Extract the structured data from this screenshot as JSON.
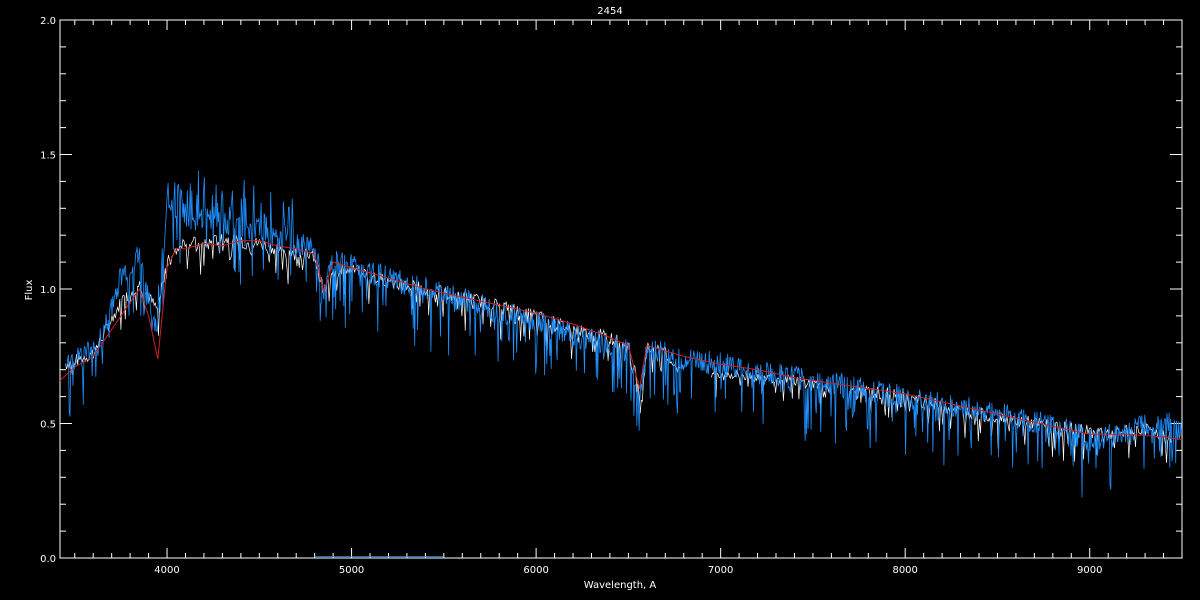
{
  "chart_data": {
    "type": "line",
    "title": "2454",
    "xlabel": "Wavelength, A",
    "ylabel": "Flux",
    "xlim": [
      3420,
      9500
    ],
    "ylim": [
      0.0,
      2.0
    ],
    "xticks": [
      4000,
      5000,
      6000,
      7000,
      8000,
      9000
    ],
    "yticks": [
      0.0,
      0.5,
      1.0,
      1.5,
      2.0
    ],
    "ytick_labels": [
      "0.0",
      "0.5",
      "1.0",
      "1.5",
      "2.0"
    ],
    "grid": false,
    "series": [
      {
        "color": "#ffffff",
        "x": [
          3450,
          3600,
          3750,
          3850,
          3950,
          4000,
          4100,
          4200,
          4300,
          4400,
          4500,
          4600,
          4700,
          4800,
          4850,
          4900,
          5000,
          5200,
          5400,
          5600,
          5800,
          6000,
          6200,
          6400,
          6500,
          6560,
          6600,
          6700,
          6780
        ],
        "y": [
          0.72,
          0.76,
          0.95,
          1.02,
          0.92,
          1.12,
          1.18,
          1.16,
          1.19,
          1.17,
          1.17,
          1.15,
          1.13,
          1.12,
          0.98,
          1.08,
          1.07,
          1.03,
          1.0,
          0.97,
          0.94,
          0.9,
          0.85,
          0.82,
          0.79,
          0.62,
          0.78,
          0.76,
          0.7
        ],
        "segment2_x": [
          6950,
          7100,
          7300,
          7500,
          7600
        ],
        "segment2_y": [
          0.69,
          0.68,
          0.67,
          0.65,
          0.63
        ],
        "segment3_x": [
          7700,
          7900,
          8100,
          8300,
          8500,
          8700,
          8900,
          9100,
          9300,
          9450
        ],
        "segment3_y": [
          0.62,
          0.61,
          0.58,
          0.55,
          0.52,
          0.5,
          0.48,
          0.46,
          0.48,
          0.44
        ]
      },
      {
        "color": "#1e90ff",
        "x": [
          3450,
          3550,
          3650,
          3750,
          3850,
          3900,
          3950,
          4000,
          4050,
          4100,
          4200,
          4300,
          4400,
          4500,
          4600,
          4700,
          4800,
          4850,
          4900,
          5000,
          5200,
          5400,
          5600,
          5800,
          6000,
          6200,
          6400,
          6500,
          6560,
          6600,
          6700,
          6800,
          7000,
          7200,
          7400,
          7600,
          7800,
          8000,
          8200,
          8400,
          8600,
          8800,
          9000,
          9200,
          9400,
          9500
        ],
        "y": [
          0.72,
          0.76,
          0.82,
          1.05,
          1.12,
          0.95,
          0.85,
          1.32,
          1.28,
          1.26,
          1.26,
          1.24,
          1.22,
          1.21,
          1.19,
          1.17,
          1.15,
          0.98,
          1.1,
          1.09,
          1.04,
          1.0,
          0.96,
          0.92,
          0.88,
          0.83,
          0.79,
          0.77,
          0.6,
          0.78,
          0.76,
          0.74,
          0.72,
          0.69,
          0.67,
          0.65,
          0.62,
          0.6,
          0.57,
          0.55,
          0.52,
          0.49,
          0.44,
          0.47,
          0.52,
          0.46
        ]
      },
      {
        "color": "#cc2222",
        "x": [
          3420,
          3500,
          3600,
          3700,
          3800,
          3850,
          3900,
          3950,
          4000,
          4050,
          4100,
          4200,
          4300,
          4400,
          4500,
          4600,
          4700,
          4800,
          4850,
          4900,
          5000,
          5200,
          5400,
          5600,
          5800,
          6000,
          6200,
          6400,
          6500,
          6560,
          6600,
          6700,
          6800,
          7000,
          7200,
          7400,
          7600,
          7800,
          8000,
          8200,
          8400,
          8600,
          8800,
          9000,
          9200,
          9400,
          9500
        ],
        "y": [
          0.66,
          0.71,
          0.75,
          0.85,
          0.95,
          1.0,
          0.9,
          0.74,
          1.08,
          1.15,
          1.15,
          1.17,
          1.16,
          1.18,
          1.18,
          1.16,
          1.15,
          1.13,
          0.99,
          1.1,
          1.08,
          1.04,
          1.0,
          0.97,
          0.94,
          0.91,
          0.87,
          0.82,
          0.79,
          0.63,
          0.79,
          0.77,
          0.75,
          0.72,
          0.7,
          0.67,
          0.65,
          0.63,
          0.61,
          0.58,
          0.55,
          0.52,
          0.49,
          0.46,
          0.46,
          0.45,
          0.44
        ]
      }
    ]
  }
}
